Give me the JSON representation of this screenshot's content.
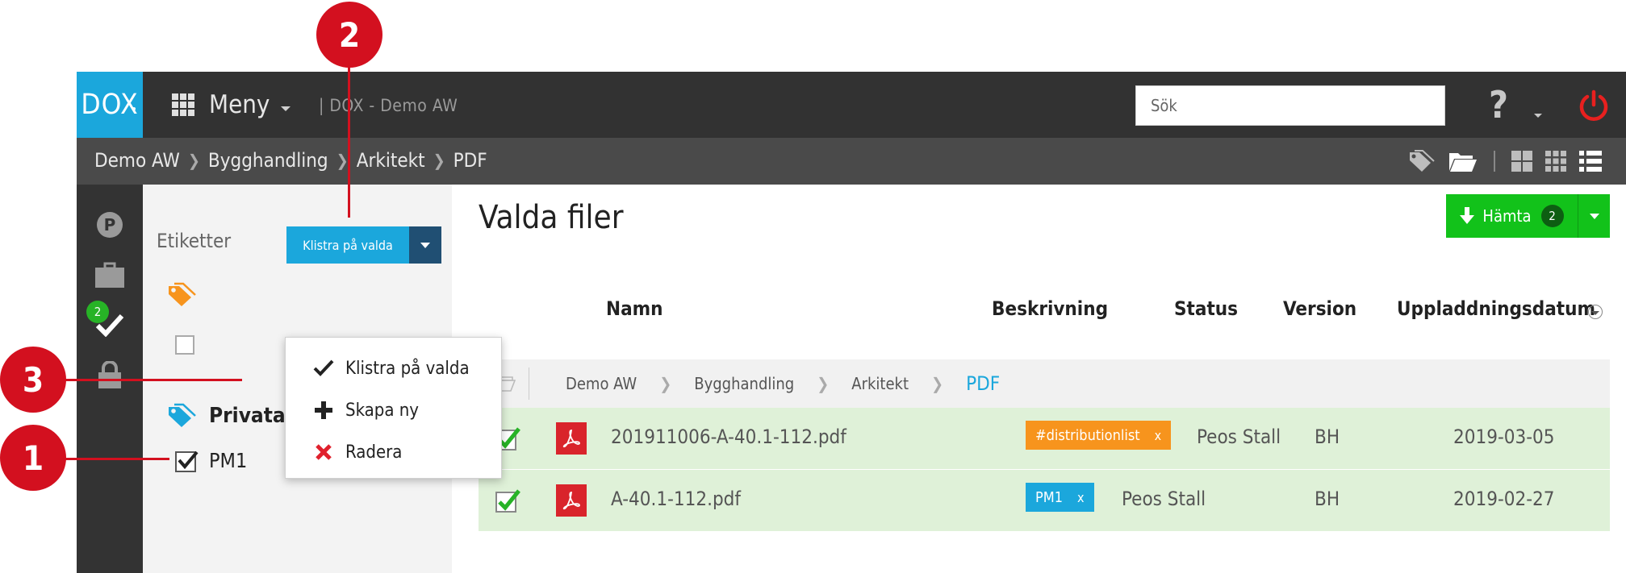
{
  "app": {
    "logo": "DOX",
    "menu_label": "Meny",
    "app_name": "| DOX - Demo AW",
    "search_placeholder": "Sök"
  },
  "breadcrumb": [
    "Demo AW",
    "Bygghandling",
    "Arkitekt",
    "PDF"
  ],
  "rail": {
    "selected_badge": "2"
  },
  "tag_panel": {
    "label": "Etiketter",
    "apply_button": "Klistra på valda",
    "group_private": "Privata",
    "tag_pm1": "PM1"
  },
  "dropdown": {
    "items": [
      {
        "label": "Klistra på valda",
        "icon": "check-icon"
      },
      {
        "label": "Skapa ny",
        "icon": "plus-icon"
      },
      {
        "label": "Radera",
        "icon": "x-icon"
      }
    ]
  },
  "main": {
    "title": "Valda filer",
    "download_button": "Hämta",
    "download_count": "2",
    "columns": [
      "Namn",
      "Beskrivning",
      "Status",
      "Version",
      "Uppladdningsdatum"
    ],
    "path": [
      "Demo AW",
      "Bygghandling",
      "Arkitekt",
      "PDF"
    ],
    "rows": [
      {
        "name": "201911006-A-40.1-112.pdf",
        "tag": "#distributionlist",
        "tag_remove": "x",
        "description": "Peos Stall",
        "version": "BH",
        "date": "2019-03-05"
      },
      {
        "name": "A-40.1-112.pdf",
        "tag": "PM1",
        "tag_remove": "x",
        "description": "Peos Stall",
        "version": "BH",
        "date": "2019-02-27"
      }
    ]
  },
  "annotations": [
    "1",
    "2",
    "3"
  ],
  "colors": {
    "accent_blue": "#1ba7dc",
    "topbar": "#323232",
    "green": "#12c21a",
    "tag_orange": "#f7941d",
    "row_selected": "#dff1d8",
    "marker_red": "#d3101f"
  }
}
